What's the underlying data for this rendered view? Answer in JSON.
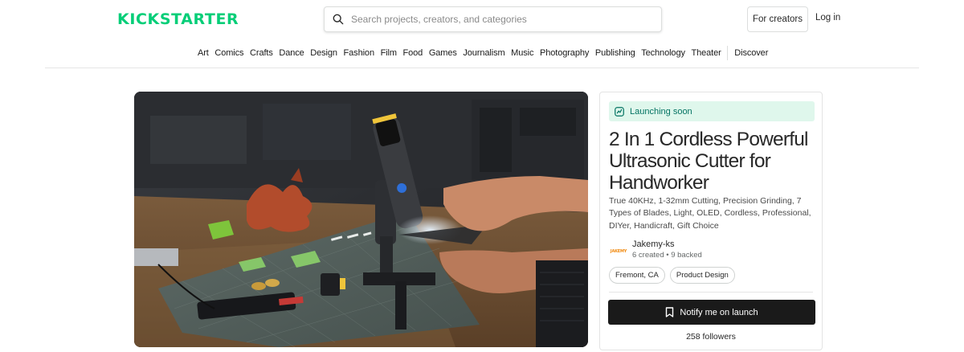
{
  "header": {
    "logo_text": "KICKSTARTER",
    "search_placeholder": "Search projects, creators, and categories",
    "for_creators_label": "For creators",
    "login_label": "Log in"
  },
  "categories": [
    "Art",
    "Comics",
    "Crafts",
    "Dance",
    "Design",
    "Fashion",
    "Film",
    "Food",
    "Games",
    "Journalism",
    "Music",
    "Photography",
    "Publishing",
    "Technology",
    "Theater"
  ],
  "discover_label": "Discover",
  "project": {
    "status_badge": "Launching soon",
    "title": "2 In 1 Cordless Powerful Ultrasonic Cutter for Handworker",
    "blurb": "True 40KHz, 1-32mm Cutting, Precision Grinding, 7 Types of Blades, Light, OLED, Cordless, Professional, DIYer, Handicraft, Gift Choice",
    "creator": {
      "name": "Jakemy-ks",
      "stats": "6 created • 9 backed",
      "logo_text": "JAKEMY"
    },
    "tags": [
      "Fremont, CA",
      "Product Design"
    ],
    "notify_label": "Notify me on launch",
    "followers": "258 followers"
  },
  "colors": {
    "brand": "#05ce78",
    "badge_bg": "#dff7ec",
    "badge_text": "#037362",
    "button_bg": "#1a1a1a"
  }
}
